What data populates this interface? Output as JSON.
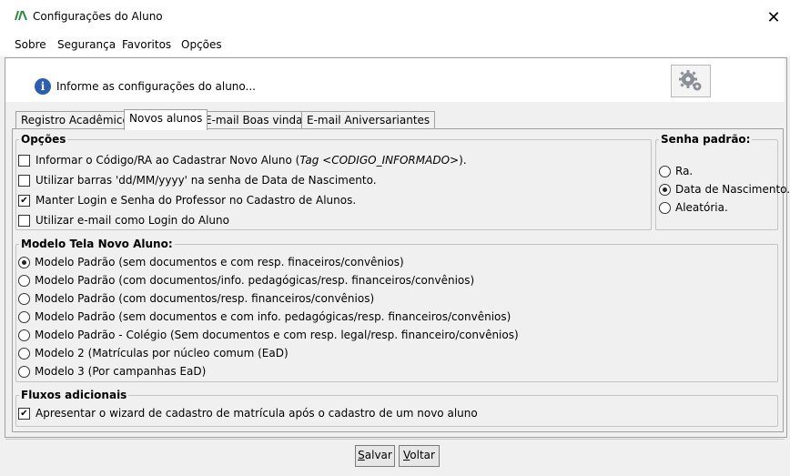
{
  "window": {
    "title": "Configurações do Aluno",
    "close_glyph": "✕"
  },
  "menu": [
    {
      "label": "Sobre"
    },
    {
      "label": "Segurança"
    },
    {
      "label": "Favoritos"
    },
    {
      "label": "Opções"
    }
  ],
  "header": {
    "info_glyph": "i",
    "text": "Informe as configurações do aluno..."
  },
  "tabs": [
    {
      "label": "Registro Acadêmico",
      "active": false
    },
    {
      "label": "Novos alunos",
      "active": true
    },
    {
      "label": "E-mail Boas vindas",
      "active": false
    },
    {
      "label": "E-mail Aniversariantes",
      "active": false
    }
  ],
  "opcoes": {
    "legend": "Opções",
    "items": [
      {
        "label_pre": "Informar o Código/RA ao Cadastrar Novo Aluno (",
        "label_em": "Tag <CODIGO_INFORMADO>",
        "label_post": ").",
        "checked": false
      },
      {
        "label": "Utilizar barras 'dd/MM/yyyy' na senha de Data de Nascimento.",
        "checked": false
      },
      {
        "label": "Manter Login e Senha do Professor no Cadastro de Alunos.",
        "checked": true
      },
      {
        "label": "Utilizar e-mail como Login do Aluno",
        "checked": false
      }
    ]
  },
  "senha": {
    "legend": "Senha padrão:",
    "options": [
      {
        "label": "Ra.",
        "selected": false
      },
      {
        "label": "Data de Nascimento.",
        "selected": true
      },
      {
        "label": "Aleatória.",
        "selected": false
      }
    ]
  },
  "modelo": {
    "legend": "Modelo Tela Novo Aluno:",
    "options": [
      {
        "label": "Modelo Padrão (sem documentos e com resp. finaceiros/convênios)",
        "selected": true
      },
      {
        "label": "Modelo Padrão (com documentos/info. pedagógicas/resp. financeiros/convênios)",
        "selected": false
      },
      {
        "label": "Modelo Padrão (com documentos/resp. financeiros/convênios)",
        "selected": false
      },
      {
        "label": "Modelo Padrão (sem documentos e com info. pedagógicas/resp. financeiros/convênios)",
        "selected": false
      },
      {
        "label": "Modelo Padrão - Colégio (Sem documentos e com resp. legal/resp. financeiro/convênios)",
        "selected": false
      },
      {
        "label": "Modelo 2 (Matrículas por núcleo comum (EaD)",
        "selected": false
      },
      {
        "label": "Modelo 3 (Por campanhas EaD)",
        "selected": false
      }
    ]
  },
  "fluxos": {
    "legend": "Fluxos adicionais",
    "items": [
      {
        "label": "Apresentar o wizard de cadastro de matrícula após o cadastro de um novo aluno",
        "checked": true
      }
    ]
  },
  "buttons": {
    "salvar": {
      "accel": "S",
      "rest": "alvar"
    },
    "voltar": {
      "accel": "V",
      "rest": "oltar"
    }
  },
  "check_glyph": "✔",
  "colors": {
    "accent": "#2d5fb0",
    "logo": "#2b8a3e"
  }
}
